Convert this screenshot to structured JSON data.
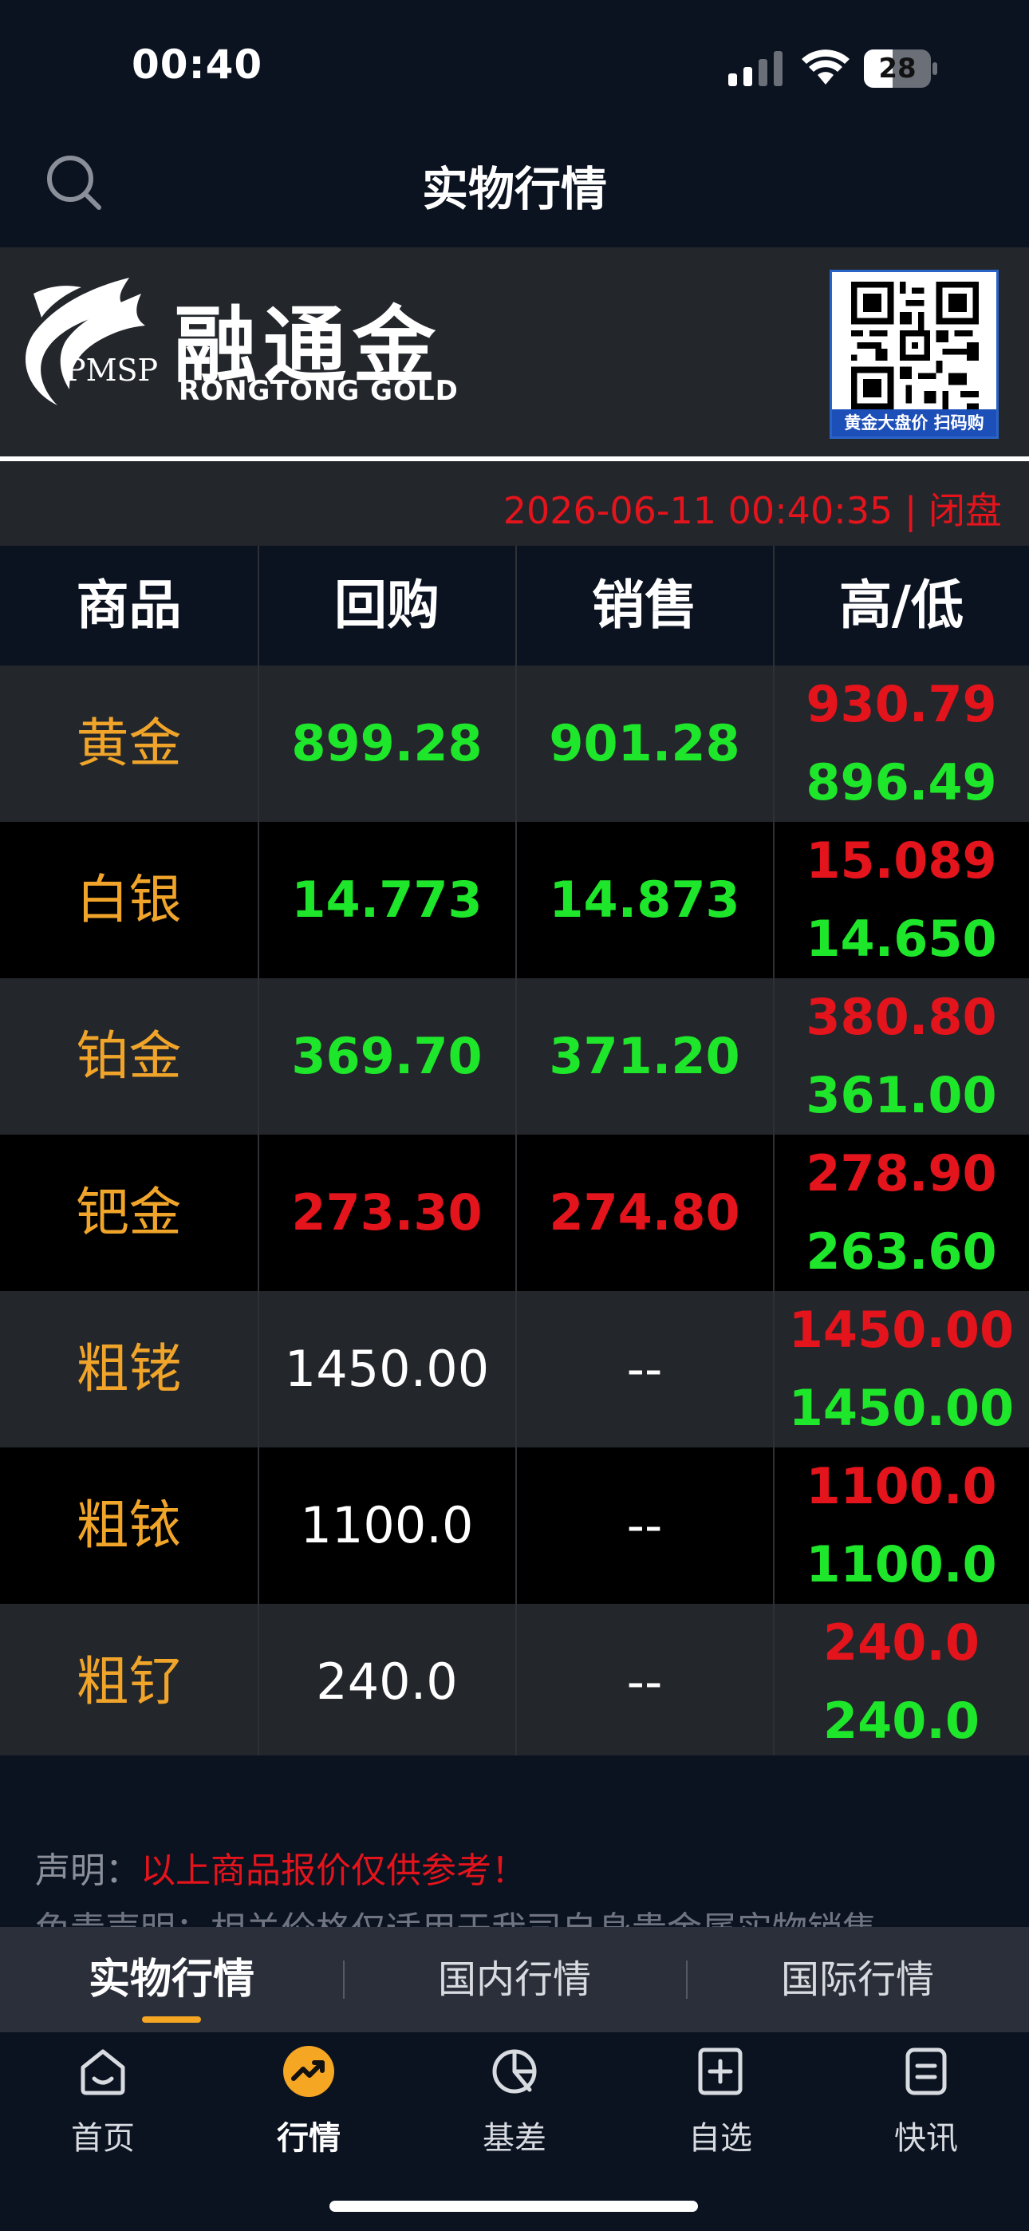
{
  "status_bar": {
    "time": "00:40",
    "battery": "28"
  },
  "nav": {
    "title": "实物行情"
  },
  "banner": {
    "logo_cn": "融通金",
    "logo_en": "RONGTONG  GOLD",
    "logo_abbr": "PMSP",
    "qr_caption": "黄金大盘价 扫码购"
  },
  "timestamp": "2026-06-11 00:40:35 | 闭盘",
  "table": {
    "headers": [
      "商品",
      "回购",
      "销售",
      "高/低"
    ],
    "rows": [
      {
        "name": "黄金",
        "buyback": "899.28",
        "sell": "901.28",
        "high": "930.79",
        "low": "896.49",
        "buy_color": "green",
        "sell_color": "green"
      },
      {
        "name": "白银",
        "buyback": "14.773",
        "sell": "14.873",
        "high": "15.089",
        "low": "14.650",
        "buy_color": "green",
        "sell_color": "green"
      },
      {
        "name": "铂金",
        "buyback": "369.70",
        "sell": "371.20",
        "high": "380.80",
        "low": "361.00",
        "buy_color": "green",
        "sell_color": "green"
      },
      {
        "name": "钯金",
        "buyback": "273.30",
        "sell": "274.80",
        "high": "278.90",
        "low": "263.60",
        "buy_color": "red",
        "sell_color": "red"
      },
      {
        "name": "粗铑",
        "buyback": "1450.00",
        "sell": "--",
        "high": "1450.00",
        "low": "1450.00",
        "buy_color": "white",
        "sell_color": "white"
      },
      {
        "name": "粗铱",
        "buyback": "1100.0",
        "sell": "--",
        "high": "1100.0",
        "low": "1100.0",
        "buy_color": "white",
        "sell_color": "white"
      },
      {
        "name": "粗钌",
        "buyback": "240.0",
        "sell": "--",
        "high": "240.0",
        "low": "240.0",
        "buy_color": "white",
        "sell_color": "white"
      }
    ]
  },
  "disclaimer": {
    "label": "声明：",
    "text": "以上商品报价仅供参考！",
    "line2": "免责声明：相关价格仅适用于我司自身贵金属实物销售"
  },
  "subtabs": [
    "实物行情",
    "国内行情",
    "国际行情"
  ],
  "tabbar": [
    {
      "label": "首页",
      "icon": "home-icon"
    },
    {
      "label": "行情",
      "icon": "market-trend-icon"
    },
    {
      "label": "基差",
      "icon": "basis-pie-icon"
    },
    {
      "label": "自选",
      "icon": "add-watchlist-icon"
    },
    {
      "label": "快讯",
      "icon": "news-icon"
    }
  ],
  "colors": {
    "up": "#e3141c",
    "down": "#1ee62a",
    "name": "#f0a52a",
    "accent": "#f5a623"
  }
}
